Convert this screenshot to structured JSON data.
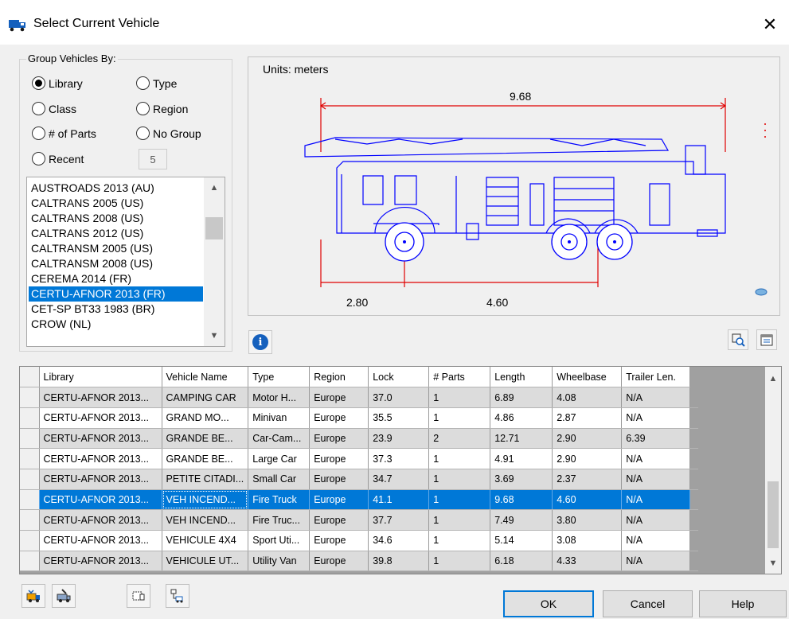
{
  "window": {
    "title": "Select Current Vehicle",
    "close_glyph": "✕"
  },
  "group": {
    "label": "Group Vehicles By:",
    "options": [
      {
        "label": "Library",
        "checked": true
      },
      {
        "label": "Type",
        "checked": false
      },
      {
        "label": "Class",
        "checked": false
      },
      {
        "label": "Region",
        "checked": false
      },
      {
        "label": "# of Parts",
        "checked": false
      },
      {
        "label": "No Group",
        "checked": false
      },
      {
        "label": "Recent",
        "checked": false
      }
    ],
    "recent_count": "5"
  },
  "libraries": {
    "items": [
      "AUSTROADS 2013 (AU)",
      "CALTRANS 2005 (US)",
      "CALTRANS 2008 (US)",
      "CALTRANS 2012 (US)",
      "CALTRANSM 2005 (US)",
      "CALTRANSM 2008 (US)",
      "CEREMA 2014 (FR)",
      "CERTU-AFNOR 2013 (FR)",
      "CET-SP BT33 1983 (BR)",
      "CROW (NL)"
    ],
    "selected_index": 7
  },
  "preview": {
    "units_label": "Units:  meters",
    "length": "9.68",
    "front_overhang": "2.80",
    "wheelbase": "4.60",
    "accent_color": "#0000ff",
    "dimension_color": "#e00000"
  },
  "grid": {
    "columns": [
      "Library",
      "Vehicle Name",
      "Type",
      "Region",
      "Lock",
      "# Parts",
      "Length",
      "Wheelbase",
      "Trailer Len."
    ],
    "rows": [
      [
        "CERTU-AFNOR 2013...",
        "CAMPING CAR",
        "Motor H...",
        "Europe",
        "37.0",
        "1",
        "6.89",
        "4.08",
        "N/A"
      ],
      [
        "CERTU-AFNOR 2013...",
        "GRAND MO...",
        "Minivan",
        "Europe",
        "35.5",
        "1",
        "4.86",
        "2.87",
        "N/A"
      ],
      [
        "CERTU-AFNOR 2013...",
        "GRANDE BE...",
        "Car-Cam...",
        "Europe",
        "23.9",
        "2",
        "12.71",
        "2.90",
        "6.39"
      ],
      [
        "CERTU-AFNOR 2013...",
        "GRANDE BE...",
        "Large Car",
        "Europe",
        "37.3",
        "1",
        "4.91",
        "2.90",
        "N/A"
      ],
      [
        "CERTU-AFNOR 2013...",
        "PETITE CITADI...",
        "Small Car",
        "Europe",
        "34.7",
        "1",
        "3.69",
        "2.37",
        "N/A"
      ],
      [
        "CERTU-AFNOR 2013...",
        "VEH INCEND...",
        "Fire Truck",
        "Europe",
        "41.1",
        "1",
        "9.68",
        "4.60",
        "N/A"
      ],
      [
        "CERTU-AFNOR 2013...",
        "VEH INCEND...",
        "Fire Truc...",
        "Europe",
        "37.7",
        "1",
        "7.49",
        "3.80",
        "N/A"
      ],
      [
        "CERTU-AFNOR 2013...",
        "VEHICULE 4X4",
        "Sport Uti...",
        "Europe",
        "34.6",
        "1",
        "5.14",
        "3.08",
        "N/A"
      ],
      [
        "CERTU-AFNOR 2013...",
        "VEHICULE UT...",
        "Utility Van",
        "Europe",
        "39.8",
        "1",
        "6.18",
        "4.33",
        "N/A"
      ]
    ],
    "row_styles": [
      "gray",
      "white",
      "gray",
      "white",
      "gray",
      "sel",
      "gray",
      "white",
      "gray"
    ],
    "selected_index": 5
  },
  "buttons": {
    "ok": "OK",
    "cancel": "Cancel",
    "help": "Help"
  }
}
